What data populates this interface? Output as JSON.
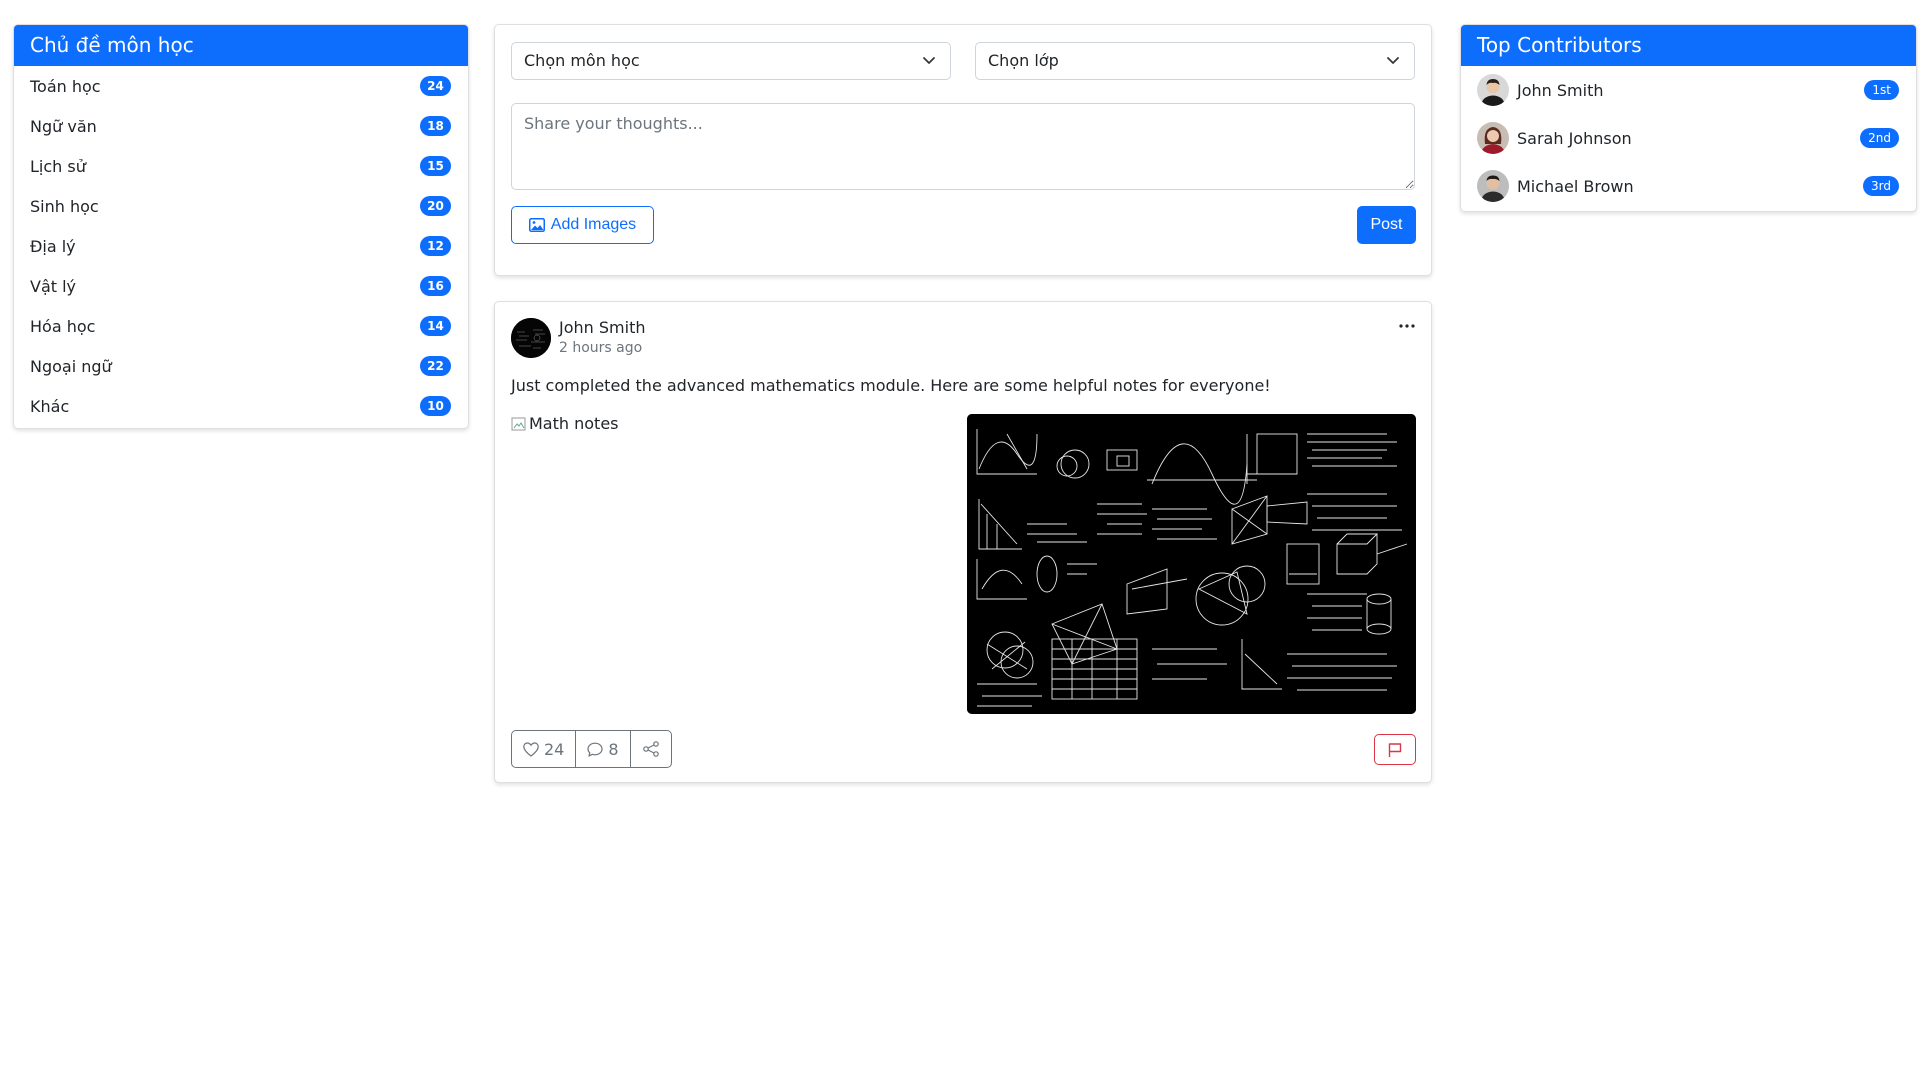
{
  "subjects": {
    "title": "Chủ đề môn học",
    "items": [
      {
        "label": "Toán học",
        "count": "24"
      },
      {
        "label": "Ngữ văn",
        "count": "18"
      },
      {
        "label": "Lịch sử",
        "count": "15"
      },
      {
        "label": "Sinh học",
        "count": "20"
      },
      {
        "label": "Địa lý",
        "count": "12"
      },
      {
        "label": "Vật lý",
        "count": "16"
      },
      {
        "label": "Hóa học",
        "count": "14"
      },
      {
        "label": "Ngoại ngữ",
        "count": "22"
      },
      {
        "label": "Khác",
        "count": "10"
      }
    ]
  },
  "composer": {
    "subject_select": "Chọn môn học",
    "class_select": "Chọn lớp",
    "placeholder": "Share your thoughts...",
    "add_images": "Add Images",
    "post": "Post"
  },
  "post": {
    "author": "John Smith",
    "time": "2 hours ago",
    "text": "Just completed the advanced mathematics module. Here are some helpful notes for everyone!",
    "image_alt": "Math notes",
    "likes": "24",
    "comments": "8"
  },
  "contributors": {
    "title": "Top Contributors",
    "items": [
      {
        "name": "John Smith",
        "rank": "1st"
      },
      {
        "name": "Sarah Johnson",
        "rank": "2nd"
      },
      {
        "name": "Michael Brown",
        "rank": "3rd"
      }
    ]
  },
  "colors": {
    "primary": "#0d6efd",
    "danger": "#dc3545",
    "muted": "#6c757d"
  },
  "icons": [
    "chevron-down-icon",
    "image-icon",
    "more-dots-icon",
    "heart-icon",
    "comment-icon",
    "share-icon",
    "flag-icon",
    "broken-image-icon"
  ]
}
